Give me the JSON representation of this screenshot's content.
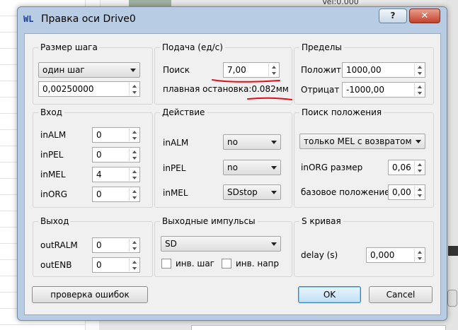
{
  "background": {
    "top_text": "Vel:0.000"
  },
  "dialog": {
    "app_icon": "WL",
    "title": "Правка оси Drive0",
    "help_button": "?",
    "close_button": "✕"
  },
  "step_size": {
    "title": "Размер шага",
    "mode_value": "один шаг",
    "step_value": "0,00250000"
  },
  "feed": {
    "title": "Подача (ед/с)",
    "search_label": "Поиск",
    "search_value": "7,00",
    "smooth_stop_label": "плавная остановка:0.082мм"
  },
  "limits": {
    "title": "Пределы",
    "positive_label": "Положит",
    "positive_value": "1000,00",
    "negative_label": "Отрицат",
    "negative_value": "-1000,00"
  },
  "input": {
    "title": "Вход",
    "rows": [
      {
        "label": "inALM",
        "value": "0"
      },
      {
        "label": "inPEL",
        "value": "0"
      },
      {
        "label": "inMEL",
        "value": "4"
      },
      {
        "label": "inORG",
        "value": "0"
      }
    ]
  },
  "action": {
    "title": "Действие",
    "rows": [
      {
        "label": "inALM",
        "value": "no"
      },
      {
        "label": "inPEL",
        "value": "no"
      },
      {
        "label": "inMEL",
        "value": "SDstop"
      }
    ]
  },
  "home_search": {
    "title": "Поиск положения",
    "mode_value": "только MEL с возвратом",
    "org_size_label": "inORG размер",
    "org_size_value": "0,06",
    "base_pos_label": "базовое положение",
    "base_pos_value": "0,00"
  },
  "output": {
    "title": "Выход",
    "rows": [
      {
        "label": "outRALM",
        "value": "0"
      },
      {
        "label": "outENB",
        "value": "0"
      }
    ]
  },
  "pulses": {
    "title": "Выходные импульсы",
    "mode_value": "SD",
    "inv_step_label": "инв. шаг",
    "inv_dir_label": "инв. напр"
  },
  "s_curve": {
    "title": "S кривая",
    "delay_label": "delay (s)",
    "delay_value": "0,000"
  },
  "buttons": {
    "check_errors": "проверка ошибок",
    "ok": "OK",
    "cancel": "Cancel"
  },
  "colors": {
    "frame": "#b8cde3",
    "annotation": "#e0101a"
  }
}
